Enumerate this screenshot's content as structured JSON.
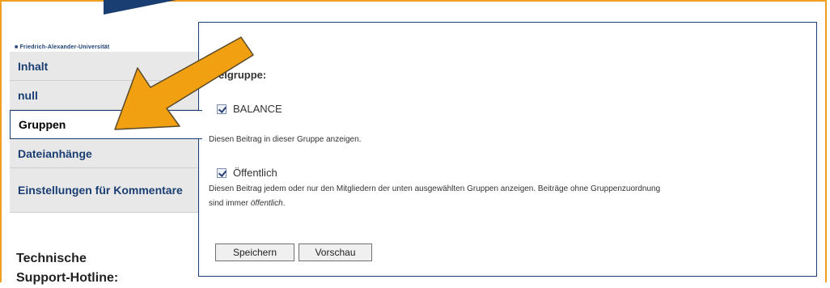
{
  "brand": {
    "university_text": "■ Friedrich-Alexander-Universität"
  },
  "nav": {
    "items": [
      {
        "label": "Inhalt"
      },
      {
        "label": "null"
      },
      {
        "label": "Gruppen"
      },
      {
        "label": "Dateianhänge"
      },
      {
        "label": "Einstellungen für Kommentare"
      }
    ],
    "active_index": 2
  },
  "support": {
    "line1": "Technische",
    "line2": "Support-Hotline:"
  },
  "panel": {
    "heading": "elgruppe:",
    "group_checkbox": {
      "label": "BALANCE",
      "checked": true
    },
    "group_hint": "Diesen Beitrag in dieser Gruppe anzeigen.",
    "public_checkbox": {
      "label": "Öffentlich",
      "checked": true
    },
    "public_hint_prefix": "Diesen Beitrag jedem oder nur den Mitgliedern der unten ausgewählten Gruppen anzeigen. Beiträge ohne Gruppenzuordnung",
    "public_hint_line2_prefix": "sind immer ",
    "public_hint_em": "öffentlich",
    "public_hint_suffix": ".",
    "save_label": "Speichern",
    "preview_label": "Vorschau"
  },
  "colors": {
    "frame": "#f0a020",
    "brand_blue": "#1a3e72",
    "arrow_fill": "#f0a010",
    "arrow_stroke": "#5a4a2a"
  }
}
